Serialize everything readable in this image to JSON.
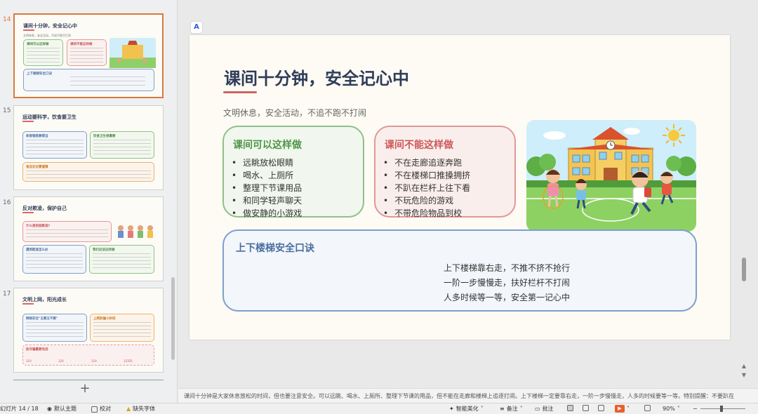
{
  "thumbnails": [
    {
      "number": "14",
      "title": "课间十分钟，安全记心中",
      "subtitle": "文明休息，安全活动，不追不跑不打闹",
      "box1": "课间可以这样做",
      "box2": "课间不能这样做",
      "box3": "上下楼梯安全口诀"
    },
    {
      "number": "15",
      "title": "运动要科学，饮食要卫生",
      "box1": "体育锻炼要得当",
      "box2": "饮食卫生很重要",
      "box3": "食品安全需谨慎"
    },
    {
      "number": "16",
      "title": "反对欺凌，保护自己",
      "box1": "什么是校园欺凌?",
      "box2": "遇到欺凌怎么办",
      "box3": "我们应该这样做"
    },
    {
      "number": "17",
      "title": "文明上网，阳光成长",
      "box1": "网络安全\"五要五不要\"",
      "box2": "上网防骗小妙招",
      "box3": "防诈骗重要电话",
      "phones": [
        "110",
        "120",
        "119",
        "12355"
      ]
    }
  ],
  "slide": {
    "title": "课间十分钟，安全记心中",
    "subtitle": "文明休息，安全活动，不追不跑不打闹",
    "do": {
      "heading": "课间可以这样做",
      "items": [
        "远眺放松眼睛",
        "喝水、上厕所",
        "整理下节课用品",
        "和同学轻声聊天",
        "做安静的小游戏"
      ]
    },
    "dont": {
      "heading": "课间不能这样做",
      "items": [
        "不在走廊追逐奔跑",
        "不在楼梯口推搡拥挤",
        "不趴在栏杆上往下看",
        "不玩危险的游戏",
        "不带危险物品到校"
      ]
    },
    "stairs": {
      "heading": "上下楼梯安全口诀",
      "lines": [
        "上下楼梯靠右走，不推不挤不抢行",
        "一阶一步慢慢走，扶好栏杆不打闹",
        "人多时候等一等，安全第一记心中"
      ]
    }
  },
  "notes": "课间十分钟是大家休息放松的时间，但也要注意安全。可以远眺、喝水、上厕所、整理下节课的用品，但不能在走廊和楼梯上追逐打闹。上下楼梯一定要靠右走，一阶一步慢慢走，人多的时候要等一等。特别提醒：不要趴在",
  "status": {
    "slide_counter": "幻灯片 14 / 18",
    "theme": "默认主题",
    "proofread": "校对",
    "missing_font": "缺失字体",
    "smart_beautify": "智能美化",
    "notes_btn": "备注",
    "comments_btn": "批注",
    "zoom": "90%"
  },
  "colors": {
    "accent_orange": "#d8793f",
    "green": "#4f9547",
    "red": "#cd5858",
    "blue": "#4a6fa0",
    "title_navy": "#2f3c5a"
  }
}
